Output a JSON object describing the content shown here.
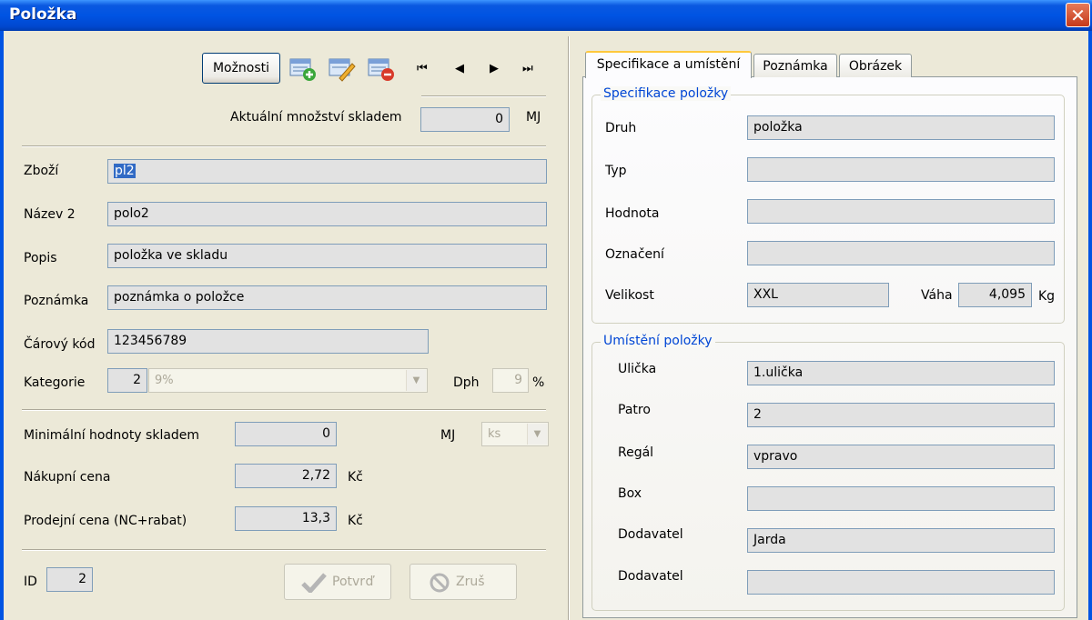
{
  "window": {
    "title": "Položka",
    "close_glyph": "✕"
  },
  "toolbar": {
    "options_label": "Možnosti",
    "icons": [
      "add-record-icon",
      "edit-record-icon",
      "delete-record-icon"
    ],
    "nav": {
      "first": "⏮",
      "prev": "◀",
      "next": "▶",
      "last": "⏭"
    }
  },
  "stock": {
    "label": "Aktuální množství skladem",
    "value": "0",
    "unit": "MJ"
  },
  "fields": {
    "zbozi": {
      "label": "Zboží",
      "value": "pl2"
    },
    "nazev2": {
      "label": "Název 2",
      "value": "polo2"
    },
    "popis": {
      "label": "Popis",
      "value": "položka ve skladu"
    },
    "poznamka": {
      "label": "Poznámka",
      "value": "poznámka o položce"
    },
    "carovy_kod": {
      "label": "Čárový kód",
      "value": "123456789"
    },
    "kategorie": {
      "label": "Kategorie",
      "code": "2",
      "selected": "9%"
    },
    "dph": {
      "label": "Dph",
      "value": "9",
      "unit": "%"
    }
  },
  "prices": {
    "min": {
      "label": "Minimální hodnoty skladem",
      "value": "0"
    },
    "mj": {
      "label": "MJ",
      "selected": "ks"
    },
    "nakupni": {
      "label": "Nákupní cena",
      "value": "2,72",
      "unit": "Kč"
    },
    "prodejni": {
      "label": "Prodejní cena  (NC+rabat)",
      "value": "13,3",
      "unit": "Kč"
    }
  },
  "footer": {
    "id_label": "ID",
    "id_value": "2",
    "confirm_label": "Potvrď",
    "cancel_label": "Zruš"
  },
  "tabs": [
    "Specifikace a umístění",
    "Poznámka",
    "Obrázek"
  ],
  "spec": {
    "title": "Specifikace položky",
    "druh": {
      "label": "Druh",
      "value": "položka"
    },
    "typ": {
      "label": "Typ",
      "value": ""
    },
    "hodnota": {
      "label": "Hodnota",
      "value": ""
    },
    "oznaceni": {
      "label": "Označení",
      "value": ""
    },
    "velikost": {
      "label": "Velikost",
      "value": "XXL"
    },
    "vaha": {
      "label": "Váha",
      "value": "4,095",
      "unit": "Kg"
    }
  },
  "location": {
    "title": "Umístění položky",
    "ulicka": {
      "label": "Ulička",
      "value": "1.ulička"
    },
    "patro": {
      "label": "Patro",
      "value": "2"
    },
    "regal": {
      "label": "Regál",
      "value": "vpravo"
    },
    "box": {
      "label": "Box",
      "value": ""
    },
    "dodavatel1": {
      "label": "Dodavatel",
      "value": "Jarda"
    },
    "dodavatel2": {
      "label": "Dodavatel",
      "value": ""
    }
  }
}
